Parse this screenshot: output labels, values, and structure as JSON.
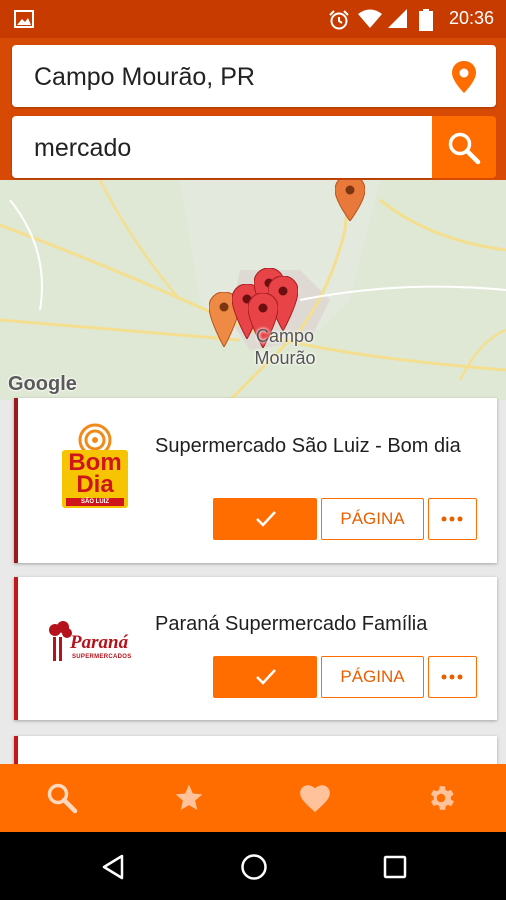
{
  "status_bar": {
    "time": "20:36"
  },
  "search": {
    "location_value": "Campo Mourão, PR",
    "query_value": "mercado"
  },
  "map": {
    "city_label_line1": "Campo",
    "city_label_line2": "Mourão",
    "attribution": "Google"
  },
  "results": [
    {
      "name": "Supermercado São Luiz - Bom dia",
      "logo_text": [
        "Bom",
        "Dia"
      ],
      "logo_caption": "SÃO LUIZ",
      "check_icon": "check-icon",
      "page_label": "PÁGINA",
      "more_icon": "more-dots-icon"
    },
    {
      "name": "Paraná Supermercado Família",
      "logo_text": "Paraná",
      "logo_caption": "SUPERMERCADOS",
      "check_icon": "check-icon",
      "page_label": "PÁGINA",
      "more_icon": "more-dots-icon"
    }
  ],
  "bottom_nav": [
    "search-icon",
    "star-icon",
    "heart-icon",
    "gear-icon"
  ],
  "colors": {
    "accent": "#ff6d00",
    "header": "#d74a05",
    "status_bar": "#c83b00",
    "card_stripe": "#c4171a"
  }
}
